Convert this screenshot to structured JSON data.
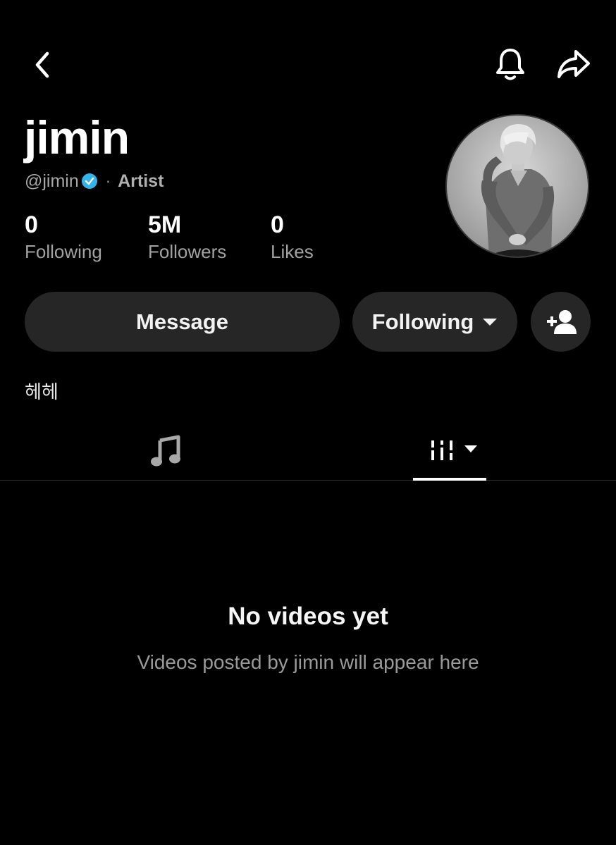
{
  "header": {
    "back_icon": "chevron-left-icon",
    "bell_icon": "bell-icon",
    "share_icon": "share-arrow-icon"
  },
  "profile": {
    "display_name": "jimin",
    "handle": "@jimin",
    "verified": true,
    "verified_color": "#34b4ea",
    "separator": "·",
    "role": "Artist",
    "bio": "헤헤"
  },
  "stats": [
    {
      "value": "0",
      "label": "Following"
    },
    {
      "value": "5M",
      "label": "Followers"
    },
    {
      "value": "0",
      "label": "Likes"
    }
  ],
  "actions": {
    "message_label": "Message",
    "following_label": "Following",
    "add_friend_icon": "add-person-icon"
  },
  "tabs": [
    {
      "icon": "music-note-icon",
      "active": false
    },
    {
      "icon": "filter-sliders-icon",
      "active": true
    }
  ],
  "empty_state": {
    "title": "No videos yet",
    "subtitle": "Videos posted by jimin will appear here"
  }
}
